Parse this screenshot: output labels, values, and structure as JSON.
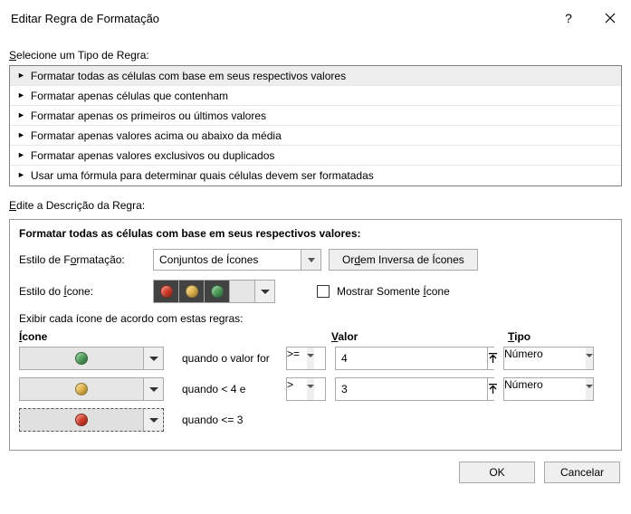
{
  "title": "Editar Regra de Formatação",
  "section_rule_type": "Selecione um Tipo de Regra:",
  "rule_types": [
    "Formatar todas as células com base em seus respectivos valores",
    "Formatar apenas células que contenham",
    "Formatar apenas os primeiros ou últimos valores",
    "Formatar apenas valores acima ou abaixo da média",
    "Formatar apenas valores exclusivos ou duplicados",
    "Usar uma fórmula para determinar quais células devem ser formatadas"
  ],
  "section_edit_desc": "Edite a Descrição da Regra:",
  "edit": {
    "heading": "Formatar todas as células com base em seus respectivos valores:",
    "format_style_label_pre": "Estilo de F",
    "format_style_label_u": "o",
    "format_style_label_post": "rmatação:",
    "format_style_value": "Conjuntos de Ícones",
    "reverse_order_pre": "Or",
    "reverse_order_u": "d",
    "reverse_order_post": "em Inversa de Ícones",
    "icon_style_label_pre": "Estilo do ",
    "icon_style_label_u": "Í",
    "icon_style_label_post": "cone:",
    "show_icon_only_pre": "Mostrar Somente ",
    "show_icon_only_u": "Í",
    "show_icon_only_post": "cone",
    "rules_intro": "Exibir cada ícone de acordo com estas regras:",
    "col_icon_u": "Í",
    "col_icon_rest": "cone",
    "col_value_u": "V",
    "col_value_rest": "alor",
    "col_type_u": "T",
    "col_type_rest": "ipo",
    "rows": [
      {
        "cond": "quando o valor for",
        "op": ">=",
        "value": "4",
        "type": "Número"
      },
      {
        "cond": "quando < 4 e",
        "op": ">",
        "value": "3",
        "type": "Número"
      },
      {
        "cond": "quando <= 3",
        "op": "",
        "value": "",
        "type": ""
      }
    ]
  },
  "footer": {
    "ok": "OK",
    "cancel": "Cancelar"
  }
}
